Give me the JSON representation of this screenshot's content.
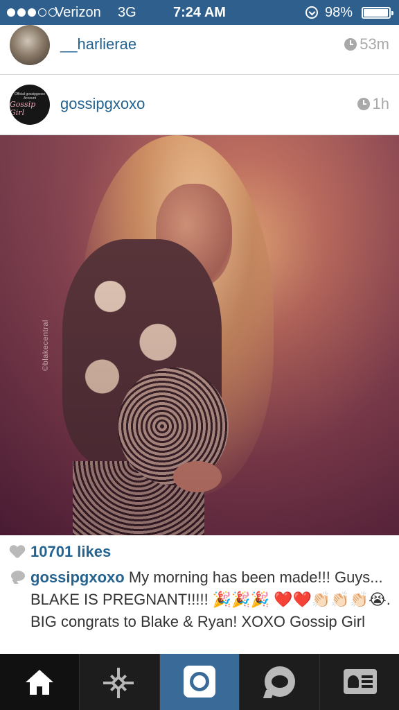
{
  "status_bar": {
    "carrier": "Verizon",
    "network": "3G",
    "time": "7:24 AM",
    "battery": "98%",
    "battery_level": 0.98,
    "signal_bars_filled": 3,
    "signal_bars_total": 5
  },
  "feed": {
    "previous_post": {
      "username": "__harlierae",
      "time": "53m"
    },
    "post": {
      "username": "gossipgxoxo",
      "time": "1h",
      "avatar_text": [
        "Official gossipgxoxo",
        "Account",
        "Gossip Girl"
      ],
      "photo_watermark": "©blakecentral",
      "likes": "10701 likes",
      "caption_author": "gossipgxoxo",
      "caption_text": "My morning has been made!!! Guys... BLAKE IS PREGNANT!!!!! 🎉🎉🎉 ❤️❤️👏🏻👏🏻👏🏻😭. BIG congrats to Blake & Ryan! XOXO Gossip Girl"
    }
  },
  "tab_bar": {
    "tabs": [
      {
        "name": "home",
        "icon": "home-icon",
        "active": true
      },
      {
        "name": "explore",
        "icon": "explore-icon"
      },
      {
        "name": "camera",
        "icon": "camera-icon"
      },
      {
        "name": "activity",
        "icon": "activity-icon"
      },
      {
        "name": "profile",
        "icon": "profile-icon"
      }
    ]
  },
  "colors": {
    "status_bar": "#2f5f8d",
    "username": "#24628f",
    "timestamp": "#a9a9a9",
    "tab_bar": "#1d1d1d",
    "camera_tab": "#3a6a98"
  }
}
